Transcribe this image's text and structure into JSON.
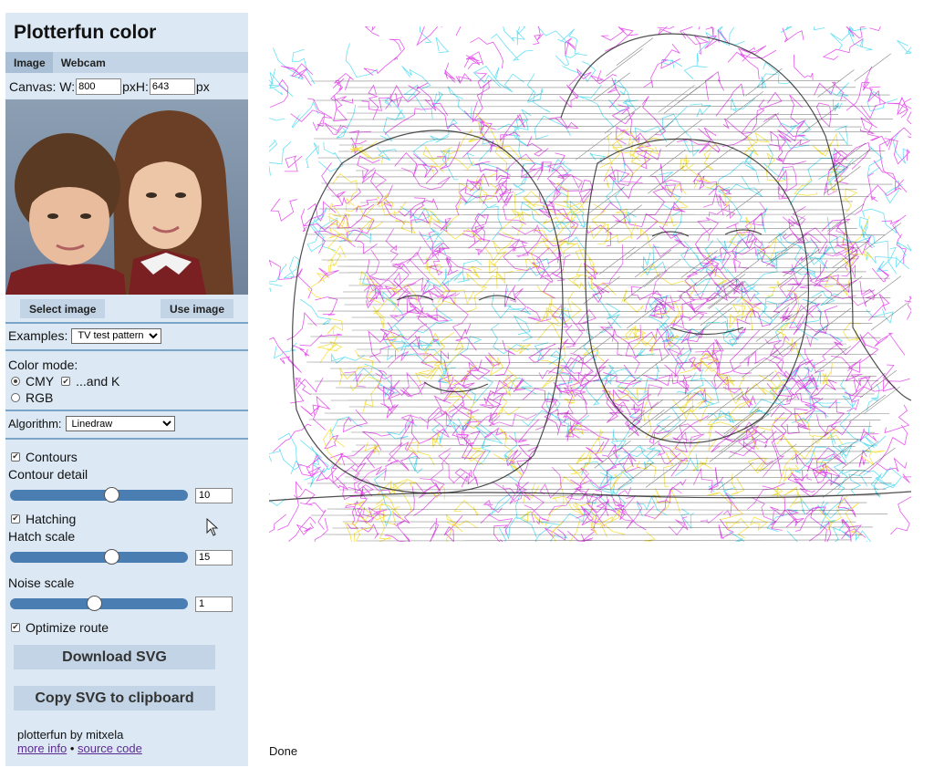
{
  "app": {
    "title": "Plotterfun color"
  },
  "tabs": [
    {
      "label": "Image",
      "active": true
    },
    {
      "label": "Webcam",
      "active": false
    }
  ],
  "canvas": {
    "label": "Canvas: W:",
    "width_value": "800",
    "px1": "px",
    "h_label": "H:",
    "height_value": "643",
    "px2": "px"
  },
  "image_buttons": {
    "select": "Select image",
    "use": "Use image"
  },
  "examples": {
    "label": "Examples:",
    "selected": "TV test pattern"
  },
  "color_mode": {
    "label": "Color mode:",
    "cmy_label": "CMY",
    "and_k_label": "...and K",
    "rgb_label": "RGB",
    "cmy_selected": true,
    "and_k_checked": true
  },
  "algorithm": {
    "label": "Algorithm:",
    "selected": "Linedraw"
  },
  "options": {
    "contours_label": "Contours",
    "contour_detail_label": "Contour detail",
    "contour_detail_value": "10",
    "contour_detail_fraction": 0.57,
    "hatching_label": "Hatching",
    "hatch_scale_label": "Hatch scale",
    "hatch_scale_value": "15",
    "hatch_scale_fraction": 0.57,
    "noise_scale_label": "Noise scale",
    "noise_scale_value": "1",
    "noise_scale_fraction": 0.47,
    "optimize_label": "Optimize route"
  },
  "actions": {
    "download": "Download SVG",
    "copy": "Copy SVG to clipboard"
  },
  "footer": {
    "credit": "plotterfun by mitxela",
    "more_info": "more info",
    "separator": "•",
    "source_code": "source code"
  },
  "status": "Done",
  "colors": {
    "sidebar_bg": "#dce9f5",
    "tab_bg": "#c2d4e5",
    "slider_track": "#4a7eb2",
    "link": "#5b2c8f",
    "pen_cyan": "#35d6f0",
    "pen_magenta": "#e030e8",
    "pen_yellow": "#f5e03a",
    "pen_black": "#222222"
  }
}
